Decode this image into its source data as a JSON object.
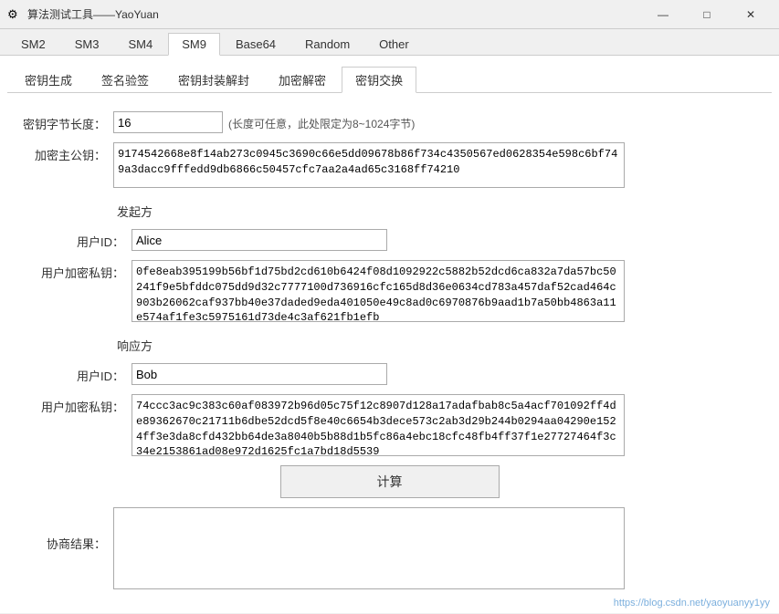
{
  "window": {
    "title": "算法测试工具——YaoYuan",
    "icon": "⚙"
  },
  "title_controls": {
    "minimize": "—",
    "maximize": "□",
    "close": "✕"
  },
  "main_tabs": [
    {
      "id": "sm2",
      "label": "SM2",
      "active": false
    },
    {
      "id": "sm3",
      "label": "SM3",
      "active": false
    },
    {
      "id": "sm4",
      "label": "SM4",
      "active": false
    },
    {
      "id": "sm9",
      "label": "SM9",
      "active": true
    },
    {
      "id": "base64",
      "label": "Base64",
      "active": false
    },
    {
      "id": "random",
      "label": "Random",
      "active": false
    },
    {
      "id": "other",
      "label": "Other",
      "active": false
    }
  ],
  "sub_tabs": [
    {
      "id": "keygen",
      "label": "密钥生成",
      "active": false
    },
    {
      "id": "sign",
      "label": "签名验签",
      "active": false
    },
    {
      "id": "encrypt",
      "label": "密钥封装解封",
      "active": false
    },
    {
      "id": "cipher",
      "label": "加密解密",
      "active": false
    },
    {
      "id": "exchange",
      "label": "密钥交换",
      "active": true
    }
  ],
  "form": {
    "key_length_label": "密钥字节长度：",
    "key_length_value": "16",
    "key_length_hint": "(长度可任意，此处限定为8~1024字节)",
    "enc_pubkey_label": "加密主公钥：",
    "enc_pubkey_value": "9174542668e8f14ab273c0945c3690c66e5dd09678b86f734c4350567ed0628354e598c6bf749a3dacc9fffedd9db6866c50457cfc7aa2a4ad65c3168ff74210",
    "origin_section": "发起方",
    "origin_userid_label": "用户ID：",
    "origin_userid_value": "Alice",
    "origin_privkey_label": "用户加密私钥：",
    "origin_privkey_value": "0fe8eab395199b56bf1d75bd2cd610b6424f08d1092922c5882b52dcd6ca832a7da57bc50241f9e5bfddc075dd9d32c7777100d736916cfc165d8d36e0634cd783a457daf52cad464c903b26062caf937bb40e37daded9eda401050e49c8ad0c6970876b9aad1b7a50bb4863a11e574af1fe3c5975161d73de4c3af621fb1efb",
    "resp_section": "响应方",
    "resp_userid_label": "用户ID：",
    "resp_userid_value": "Bob",
    "resp_privkey_label": "用户加密私钥：",
    "resp_privkey_value": "74ccc3ac9c383c60af083972b96d05c75f12c8907d128a17adafbab8c5a4acf701092ff4de89362670c21711b6dbe52dcd5f8e40c6654b3dece573c2ab3d29b244b0294aa04290e1524ff3e3da8cfd432bb64de3a8040b5b88d1b5fc86a4ebc18cfc48fb4ff37f1e27727464f3c34e2153861ad08e972d1625fc1a7bd18d5539",
    "calc_button": "计算",
    "result_label": "协商结果：",
    "result_value": ""
  },
  "watermark": "https://blog.csdn.net/yaoyuanyy1yy"
}
